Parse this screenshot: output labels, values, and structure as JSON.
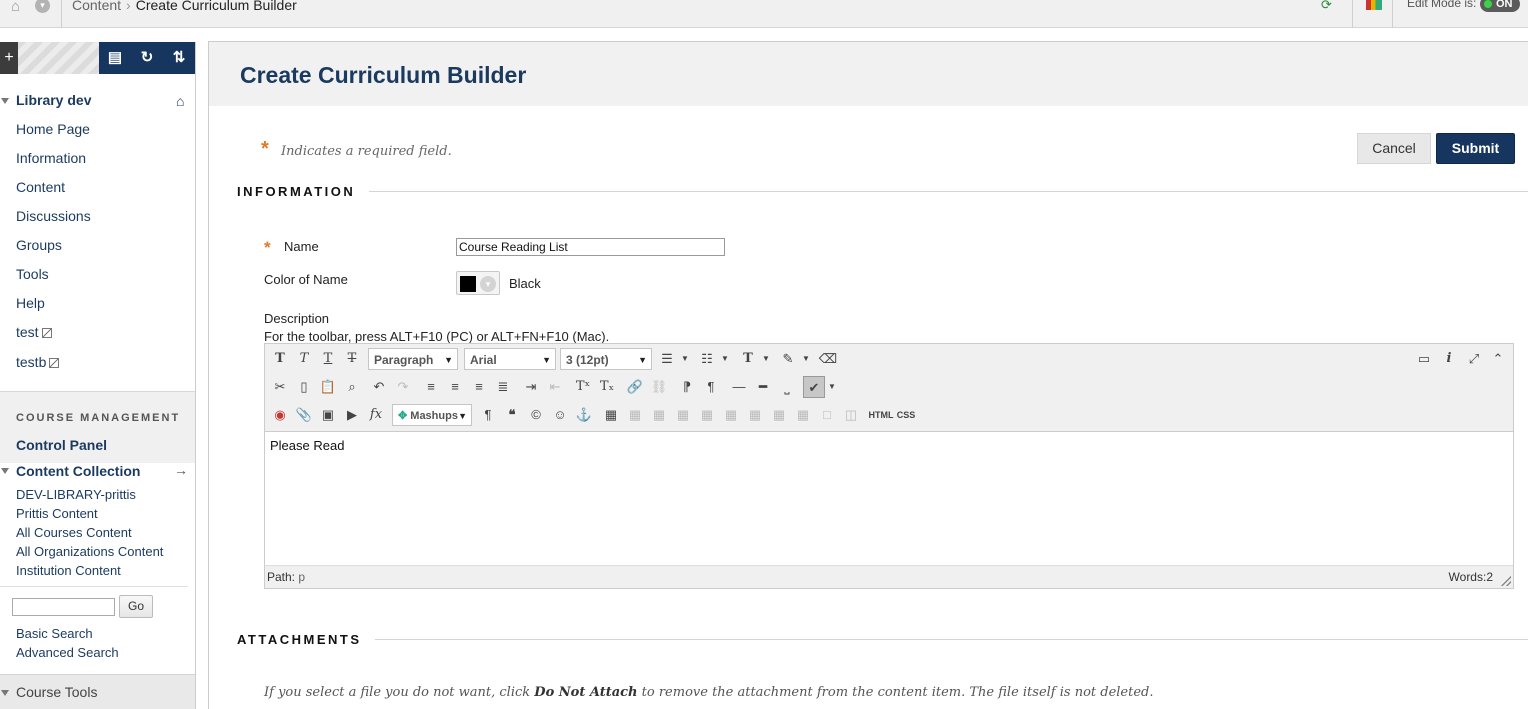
{
  "breadcrumb": {
    "parent": "Content",
    "separator": "›",
    "current": "Create Curriculum Builder"
  },
  "topbar": {
    "edit_mode_label": "Edit Mode is:",
    "edit_mode_value": "ON"
  },
  "sidebar": {
    "course_title": "Library dev",
    "items": [
      {
        "label": "Home Page"
      },
      {
        "label": "Information"
      },
      {
        "label": "Content"
      },
      {
        "label": "Discussions"
      },
      {
        "label": "Groups"
      },
      {
        "label": "Tools"
      },
      {
        "label": "Help"
      },
      {
        "label": "test"
      },
      {
        "label": "testb"
      }
    ],
    "course_management_label": "COURSE MANAGEMENT",
    "control_panel_label": "Control Panel",
    "content_collection_label": "Content Collection",
    "content_collection_items": [
      {
        "label": "DEV-LIBRARY-prittis"
      },
      {
        "label": "Prittis Content"
      },
      {
        "label": "All Courses Content"
      },
      {
        "label": "All Organizations Content"
      },
      {
        "label": "Institution Content"
      }
    ],
    "go_label": "Go",
    "basic_search": "Basic Search",
    "advanced_search": "Advanced Search",
    "course_tools_label": "Course Tools"
  },
  "page": {
    "title": "Create Curriculum Builder",
    "required_note": "Indicates a required field.",
    "cancel_label": "Cancel",
    "submit_label": "Submit",
    "information_heading": "INFORMATION",
    "name_label": "Name",
    "name_value": "Course Reading List",
    "color_label": "Color of Name",
    "color_value": "Black",
    "color_hex": "#000000",
    "description_label": "Description",
    "toolbar_hint": "For the toolbar, press ALT+F10 (PC) or ALT+FN+F10 (Mac).",
    "attachments_heading": "ATTACHMENTS",
    "attach_note_pre": "If you select a file you do not want, click ",
    "attach_note_bold": "Do Not Attach",
    "attach_note_post": " to remove the attachment from the content item. The file itself is not deleted."
  },
  "editor": {
    "format_select": "Paragraph",
    "font_select": "Arial",
    "size_select": "3 (12pt)",
    "mashups_label": "Mashups",
    "html_label": "HTML",
    "css_label": "CSS",
    "content": "Please Read",
    "path_label": "Path:",
    "path_value": "p",
    "word_count": "Words:2"
  },
  "colors": {
    "navy": "#16365f",
    "accent_orange": "#e07b28",
    "header_gray": "#f1f1f1"
  }
}
